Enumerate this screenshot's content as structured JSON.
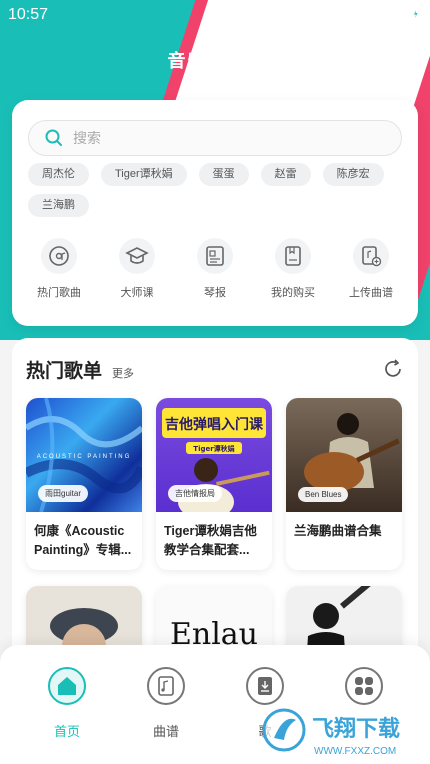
{
  "status": {
    "time": "10:57"
  },
  "header": {
    "title": "音乐情报局"
  },
  "search": {
    "placeholder": "搜索"
  },
  "tags": [
    "周杰伦",
    "Tiger谭秋娟",
    "蛋蛋",
    "赵雷",
    "陈彦宏",
    "兰海鹏"
  ],
  "shortcuts": [
    {
      "label": "热门歌曲",
      "icon": "music-disc-icon"
    },
    {
      "label": "大师课",
      "icon": "graduation-cap-icon"
    },
    {
      "label": "琴报",
      "icon": "newspaper-icon"
    },
    {
      "label": "我的购买",
      "icon": "book-icon"
    },
    {
      "label": "上传曲谱",
      "icon": "upload-score-icon"
    }
  ],
  "hot": {
    "title": "热门歌单",
    "more": "更多",
    "playlists": [
      {
        "name": "何康《Acoustic Painting》专辑...",
        "badge": "雨田guitar",
        "cover_text": "ACOUSTIC PAINTING"
      },
      {
        "name": "Tiger谭秋娟吉他教学合集配套...",
        "badge": "吉他情报局",
        "cover_text": "吉他弹唱入门课",
        "cover_sub": "Tiger谭秋娟"
      },
      {
        "name": "兰海鹏曲谱合集",
        "badge": "Ben Blues"
      },
      {
        "name": "",
        "badge": ""
      },
      {
        "name": "",
        "badge": "",
        "cover_text": "Enlau"
      },
      {
        "name": "",
        "badge": ""
      }
    ]
  },
  "tabs": [
    {
      "label": "首页",
      "icon": "home-icon",
      "active": true
    },
    {
      "label": "曲谱",
      "icon": "score-icon",
      "active": false
    },
    {
      "label": "歌",
      "icon": "song-icon",
      "active": false
    },
    {
      "label": "",
      "icon": "grid-icon",
      "active": false
    }
  ],
  "watermark": {
    "text": "飞翔下载",
    "url": "WWW.FXXZ.COM"
  },
  "colors": {
    "accent": "#19bfb7",
    "pink": "#f0426a"
  }
}
